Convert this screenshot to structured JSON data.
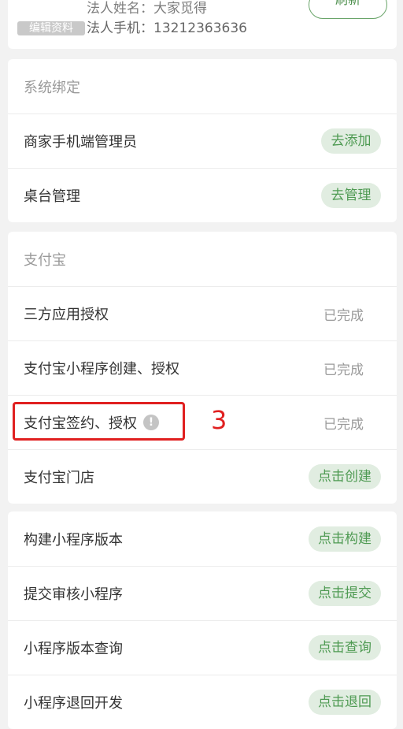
{
  "top_card": {
    "legal_name_text": "法人姓名：大家觅得",
    "legal_phone_text": "法人手机：13212363636",
    "edit_profile_label": "编辑资料",
    "refresh_label": "刷新"
  },
  "system_binding": {
    "title": "系统绑定",
    "items": [
      {
        "label": "商家手机端管理员",
        "action": "去添加"
      },
      {
        "label": "桌台管理",
        "action": "去管理"
      }
    ]
  },
  "alipay": {
    "title": "支付宝",
    "items": [
      {
        "label": "三方应用授权",
        "status": "已完成"
      },
      {
        "label": "支付宝小程序创建、授权",
        "status": "已完成"
      },
      {
        "label": "支付宝签约、授权",
        "status": "已完成",
        "info_icon": "!"
      },
      {
        "label": "支付宝门店",
        "action": "点击创建"
      }
    ]
  },
  "mini_program": {
    "items": [
      {
        "label": "构建小程序版本",
        "action": "点击构建"
      },
      {
        "label": "提交审核小程序",
        "action": "点击提交"
      },
      {
        "label": "小程序版本查询",
        "action": "点击查询"
      },
      {
        "label": "小程序退回开发",
        "action": "点击退回"
      }
    ]
  },
  "annotation": {
    "number": "3",
    "color": "#e02020"
  },
  "colors": {
    "accent_green": "#4e9a52",
    "pill_bg": "#e1ede1",
    "page_bg": "#f2f2f2"
  }
}
